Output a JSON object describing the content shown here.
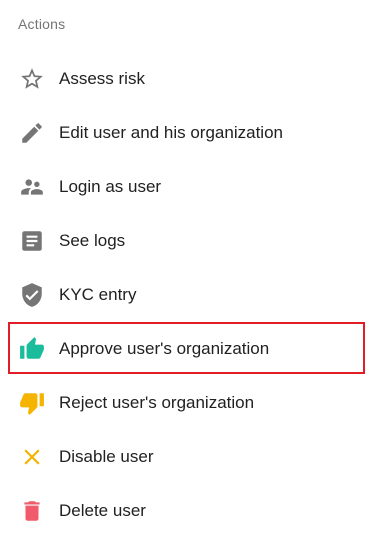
{
  "section": {
    "title": "Actions"
  },
  "colors": {
    "icon_gray": "#757575",
    "approve_green": "#1abc9c",
    "reject_amber": "#f5b400",
    "disable_orange": "#f5b400",
    "delete_red": "#f05a6a",
    "highlight_border": "#e01e25"
  },
  "menu": {
    "items": [
      {
        "label": "Assess risk",
        "icon": "star-icon"
      },
      {
        "label": "Edit user and his organization",
        "icon": "pencil-icon"
      },
      {
        "label": "Login as user",
        "icon": "people-icon"
      },
      {
        "label": "See logs",
        "icon": "document-icon"
      },
      {
        "label": "KYC entry",
        "icon": "shield-check-icon"
      },
      {
        "label": "Approve user's organization",
        "icon": "thumbs-up-icon",
        "highlighted": true
      },
      {
        "label": "Reject user's organization",
        "icon": "thumbs-down-icon"
      },
      {
        "label": "Disable user",
        "icon": "close-icon"
      },
      {
        "label": "Delete user",
        "icon": "trash-icon"
      }
    ]
  }
}
